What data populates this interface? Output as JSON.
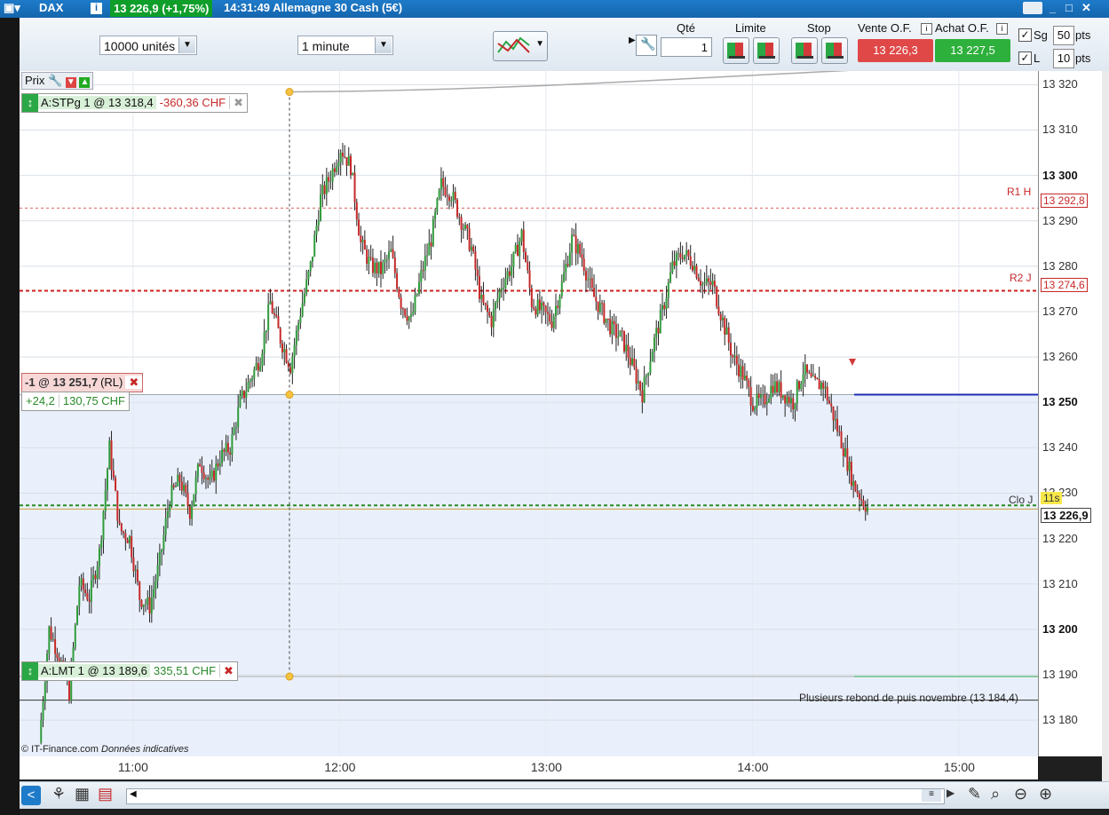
{
  "window": {
    "instrument": "DAX",
    "info_glyph": "i",
    "price_badge": "13 226,9 (+1,75%)",
    "title": "14:31:49 Allemagne 30 Cash (5€)",
    "controls": [
      "_",
      "□",
      "✕"
    ]
  },
  "toolbar": {
    "units": "10000 unités",
    "period": "1 minute",
    "qty_label": "Qté",
    "qty_value": "1",
    "limit_label": "Limite",
    "stop_label": "Stop",
    "sell_label": "Vente O.F.",
    "buy_label": "Achat O.F.",
    "sell_price": "13 226,3",
    "buy_price": "13 227,5",
    "sg_label": "Sg",
    "sg_value": "50",
    "l_label": "L",
    "l_value": "10",
    "pts": "pts"
  },
  "chart_header": {
    "label": "Prix"
  },
  "orders": {
    "stop": {
      "label": "A:STPg 1 @ 13 318,4",
      "pnl": "-360,36 CHF"
    },
    "position": {
      "label": "-1 @ 13 251,7",
      "tag": "(RL)",
      "pts": "+24,2",
      "pnl": "130,75 CHF"
    },
    "limit": {
      "label": "A:LMT 1 @ 13 189,6",
      "pnl": "335,51 CHF"
    }
  },
  "annotations": {
    "r1": "R1 H",
    "r2": "R2 J",
    "clo": "Clo J",
    "support": "Plusieurs rebond de puis novembre (13 184,4)",
    "countdown": "11s",
    "credit": "© IT-Finance.com",
    "credit_note": "Données indicatives"
  },
  "axis_tags": {
    "r1": "13 292,8",
    "r2": "13 274,6",
    "last": "13 226,9"
  },
  "colors": {
    "up": "#2f9b3b",
    "down": "#c62828",
    "stop_line": "#c0392b",
    "position_line": "#1c2fb5",
    "limit_line": "#2aa845",
    "accent": "#1465ad"
  },
  "chart_data": {
    "type": "candlestick",
    "symbol": "DAX",
    "interval": "1 minute",
    "y_ticks": [
      "13 320",
      "13 310",
      "13 300",
      "13 290",
      "13 280",
      "13 270",
      "13 260",
      "13 250",
      "13 240",
      "13 230",
      "13 220",
      "13 210",
      "13 200",
      "13 190",
      "13 180"
    ],
    "y_bold": [
      "13 300",
      "13 250",
      "13 200"
    ],
    "x_ticks": [
      "11:00",
      "12:00",
      "13:00",
      "14:00",
      "15:00"
    ],
    "ylim": [
      13172,
      13323
    ],
    "xlim": [
      "10:27",
      "15:23"
    ],
    "levels": {
      "r1": 13292.8,
      "r2": 13274.6,
      "clo": 13227.3,
      "last": 13226.9,
      "position": 13251.7,
      "stop": 13318.4,
      "limit": 13189.6,
      "support": 13184.4
    },
    "closes": [
      [
        0,
        13175
      ],
      [
        5,
        13200
      ],
      [
        10,
        13194
      ],
      [
        15,
        13186
      ],
      [
        20,
        13210
      ],
      [
        25,
        13207
      ],
      [
        30,
        13217
      ],
      [
        35,
        13240
      ],
      [
        40,
        13222
      ],
      [
        45,
        13220
      ],
      [
        50,
        13207
      ],
      [
        55,
        13205
      ],
      [
        60,
        13215
      ],
      [
        65,
        13229
      ],
      [
        70,
        13233
      ],
      [
        75,
        13226
      ],
      [
        80,
        13237
      ],
      [
        85,
        13232
      ],
      [
        90,
        13238
      ],
      [
        95,
        13240
      ],
      [
        100,
        13250
      ],
      [
        105,
        13255
      ],
      [
        110,
        13260
      ],
      [
        115,
        13272
      ],
      [
        120,
        13264
      ],
      [
        125,
        13258
      ],
      [
        130,
        13270
      ],
      [
        135,
        13280
      ],
      [
        140,
        13295
      ],
      [
        145,
        13300
      ],
      [
        150,
        13306
      ],
      [
        155,
        13302
      ],
      [
        160,
        13285
      ],
      [
        165,
        13280
      ],
      [
        170,
        13279
      ],
      [
        175,
        13283
      ],
      [
        180,
        13272
      ],
      [
        185,
        13268
      ],
      [
        190,
        13278
      ],
      [
        195,
        13286
      ],
      [
        200,
        13298
      ],
      [
        205,
        13296
      ],
      [
        210,
        13290
      ],
      [
        215,
        13284
      ],
      [
        220,
        13272
      ],
      [
        225,
        13268
      ],
      [
        230,
        13276
      ],
      [
        235,
        13280
      ],
      [
        240,
        13287
      ],
      [
        245,
        13272
      ],
      [
        250,
        13270
      ],
      [
        255,
        13268
      ],
      [
        260,
        13276
      ],
      [
        265,
        13286
      ],
      [
        270,
        13282
      ],
      [
        275,
        13274
      ],
      [
        280,
        13270
      ],
      [
        285,
        13266
      ],
      [
        290,
        13264
      ],
      [
        295,
        13258
      ],
      [
        300,
        13252
      ],
      [
        305,
        13262
      ],
      [
        310,
        13270
      ],
      [
        315,
        13280
      ],
      [
        320,
        13283
      ],
      [
        325,
        13281
      ],
      [
        330,
        13276
      ],
      [
        335,
        13276
      ],
      [
        340,
        13268
      ],
      [
        345,
        13260
      ],
      [
        350,
        13256
      ],
      [
        355,
        13250
      ],
      [
        360,
        13250
      ],
      [
        365,
        13254
      ],
      [
        370,
        13252
      ],
      [
        375,
        13250
      ],
      [
        380,
        13257
      ],
      [
        385,
        13254
      ],
      [
        390,
        13254
      ],
      [
        395,
        13247
      ],
      [
        400,
        13240
      ],
      [
        405,
        13232
      ],
      [
        410,
        13228
      ],
      [
        412,
        13226.9
      ]
    ]
  }
}
